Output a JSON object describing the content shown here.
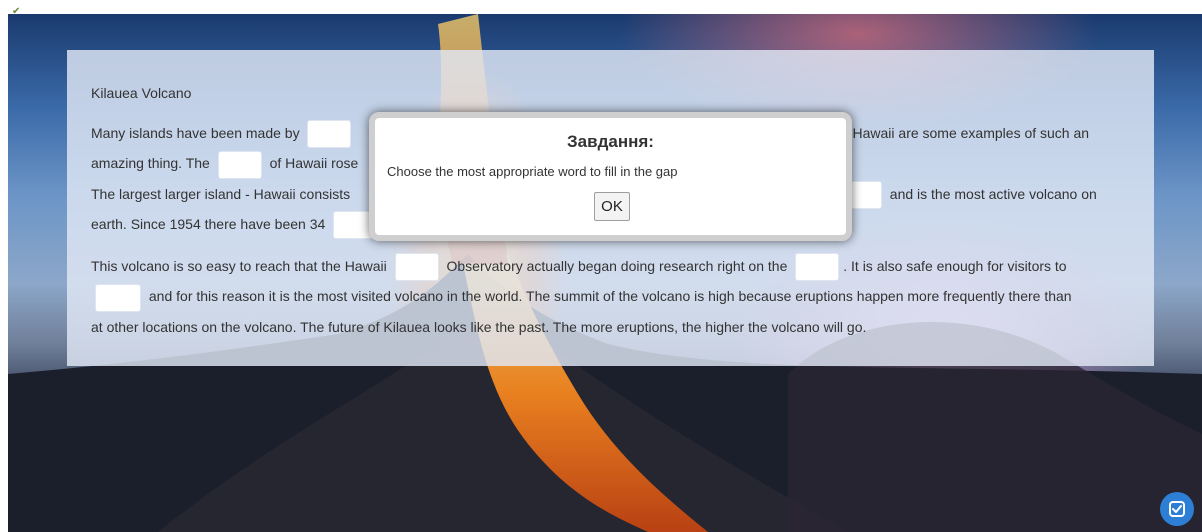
{
  "document": {
    "title": "Kilauea Volcano",
    "p1_a": "Many islands have been made by",
    "p1_b": "and Hawaii are some examples of such an",
    "p1_c": "amazing thing. The",
    "p1_d": "of Hawaii rose",
    "p1_e": "The largest larger island - Hawaii consists",
    "p1_f": "and is the most active volcano on",
    "p1_g": "earth. Since 1954 there have been 34",
    "p2_a": "This volcano is so easy to reach that the Hawaii",
    "p2_b": "Observatory actually began doing research right on the",
    "p2_c": ". It is also safe enough for visitors to",
    "p2_d": "and for this reason it is the most visited volcano in the world. The summit of the volcano is high because eruptions happen more frequently there than",
    "p2_e": "at other locations on the volcano. The future of Kilauea looks like the past. The more eruptions, the higher the volcano will go."
  },
  "modal": {
    "title": "Завдання:",
    "text": "Choose the most appropriate word to fill in the gap",
    "ok_label": "OK"
  },
  "icons": {
    "check": "check-square-icon",
    "corner": "corner-arrow-icon"
  },
  "colors": {
    "accent": "#2d7fd6",
    "panel": "#e1e8f5"
  }
}
